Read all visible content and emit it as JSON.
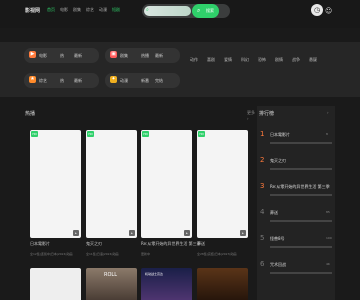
{
  "header": {
    "logo": "影视网",
    "nav": [
      "首页",
      "电影",
      "剧集",
      "综艺",
      "动漫",
      "短剧"
    ],
    "search_placeholder": "搜索影片",
    "search_btn": "搜索",
    "history_icon": "clock-icon",
    "user_icon": "user-icon"
  },
  "cats": [
    {
      "icon": "movie-icon",
      "color": "#ff7a3c",
      "t1": "电影",
      "t2": "热",
      "t3": "最新"
    },
    {
      "icon": "tv-icon",
      "color": "#ff5a5a",
      "t1": "剧集",
      "t2": "热播",
      "t3": "最新"
    },
    {
      "icon": "variety-icon",
      "color": "#ff8a2a",
      "t1": "综艺",
      "t2": "热",
      "t3": "最新"
    },
    {
      "icon": "anime-icon",
      "color": "#f0b020",
      "t1": "动漫",
      "t2": "新番",
      "t3": "完结"
    }
  ],
  "tags": [
    "动作",
    "喜剧",
    "爱情",
    "科幻",
    "恐怖",
    "剧情",
    "战争",
    "悬疑"
  ],
  "main": {
    "title": "热播",
    "more": "更多 ›",
    "cards": [
      {
        "badge": "HD",
        "title": "日本電影片",
        "desc": "全12集|连载中|日本|2024|动画"
      },
      {
        "badge": "HD",
        "title": "鬼灭之刃",
        "desc": "全11集|日语|2024|动画"
      },
      {
        "badge": "HD",
        "title": "Re:从零开始的异世界生活 第三季",
        "desc": "更新中"
      },
      {
        "badge": "HD",
        "title": "葬送",
        "desc": "全28集|完结|日本|2023|动画"
      }
    ],
    "card2": [
      {
        "color": "#eeeeee",
        "label": ""
      },
      {
        "color": "#50433b",
        "label": "ROLL"
      },
      {
        "color": "#2b2a5a",
        "label": "机动战士高达"
      },
      {
        "color": "#2a1a10",
        "label": ""
      }
    ]
  },
  "rank": {
    "title": "排行榜",
    "more": "›",
    "items": [
      {
        "num": "1",
        "name": "日本電影片",
        "cnt": "8"
      },
      {
        "num": "2",
        "name": "鬼灭之刃",
        "cnt": ""
      },
      {
        "num": "3",
        "name": "Re:从零开始的异世界生活 第三季",
        "cnt": "57"
      },
      {
        "num": "4",
        "name": "葬送",
        "cnt": "85"
      },
      {
        "num": "5",
        "name": "怪兽8号",
        "cnt": "100"
      },
      {
        "num": "6",
        "name": "咒术回战",
        "cnt": "4K"
      }
    ]
  }
}
